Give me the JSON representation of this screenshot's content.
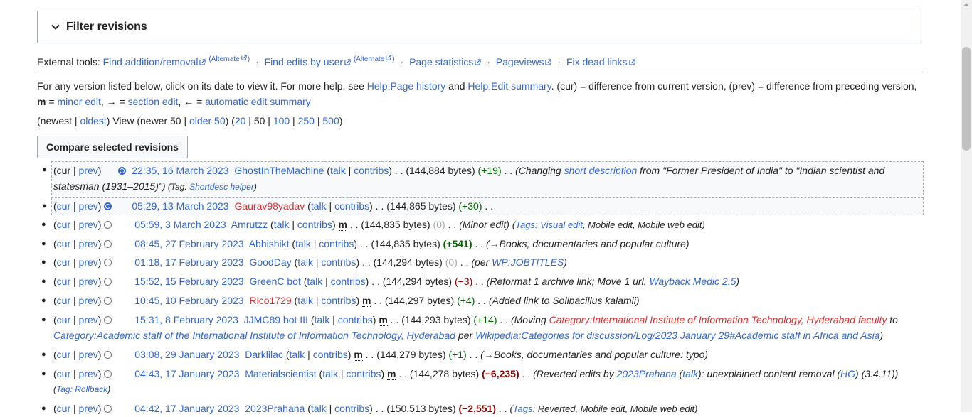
{
  "filter": {
    "title": "Filter revisions"
  },
  "external_tools": {
    "label": "External tools:",
    "find_addition": "Find addition/removal",
    "alternate1": "(Alternate",
    "alternate1_close": ")",
    "find_edits": "Find edits by user",
    "alternate2": "(Alternate",
    "alternate2_close": ")",
    "page_statistics": "Page statistics",
    "pageviews": "Pageviews",
    "fix_dead_links": "Fix dead links",
    "sep": "·"
  },
  "help": {
    "t1": "For any version listed below, click on its date to view it. For more help, see ",
    "help_page_history": "Help:Page history",
    "t2": " and ",
    "help_edit_summary": "Help:Edit summary",
    "t3": ". (cur) = difference from current version, (prev) = difference from preceding version,",
    "m": "m",
    "t4": " = ",
    "minor_edit": "minor edit",
    "t5": ", → = ",
    "section_edit": "section edit",
    "t6": ", ← = ",
    "automatic_edit_summary": "automatic edit summary"
  },
  "nav": {
    "open": "(newest | ",
    "oldest": "oldest",
    "view": ") View (newer 50 | ",
    "older50": "older 50",
    "mid": ") (",
    "n20": "20",
    "s1": " | 50 | ",
    "n100": "100",
    "s2": " | ",
    "n250": "250",
    "s3": " | ",
    "n500": "500",
    "close": ")"
  },
  "compare_button": "Compare selected revisions",
  "revisions": [
    {
      "cur": "cur",
      "prev": "prev",
      "date": "22:35, 16 March 2023",
      "user": "GhostInTheMachine",
      "talk": "talk",
      "contribs": "contribs",
      "bytes": "(144,884 bytes)",
      "diff": "(+19)",
      "s1": "(Changing ",
      "s_link1": "short description",
      "s2": " from \"Former President of India\" to \"Indian scientist and",
      "l2a": "statesman (1931–2015)\")",
      "tag_open": " (Tag: ",
      "tag_link": "Shortdesc helper",
      "tag_close": ")"
    },
    {
      "cur": "cur",
      "prev": "prev",
      "date": "05:29, 13 March 2023",
      "user": "Gaurav98yadav",
      "talk": "talk",
      "contribs": "contribs",
      "bytes": "(144,865 bytes)",
      "diff": "(+30)",
      "dots": ". ."
    },
    {
      "cur": "cur",
      "prev": "prev",
      "date": "05:59, 3 March 2023",
      "user": "Amrutzz",
      "talk": "talk",
      "contribs": "contribs",
      "minor": "m",
      "bytes": "(144,835 bytes)",
      "diff": "(0)",
      "summary": "(Minor edit)",
      "tags_open": "(",
      "tags_label": "Tags:",
      "tag1": " Visual edit",
      "tag_rest": ", Mobile edit, Mobile web edit)"
    },
    {
      "cur": "cur",
      "prev": "prev",
      "date": "08:45, 27 February 2023",
      "user": "Abhishikt",
      "talk": "talk",
      "contribs": "contribs",
      "bytes": "(144,835 bytes)",
      "diff": "(+541)",
      "s_open": "(",
      "arrow": "→",
      "s_rest": "Books, documentaries and popular culture)"
    },
    {
      "cur": "cur",
      "prev": "prev",
      "date": "01:18, 17 February 2023",
      "user": "GoodDay",
      "talk": "talk",
      "contribs": "contribs",
      "bytes": "(144,294 bytes)",
      "diff": "(0)",
      "s_open": "(per ",
      "s_link": "WP:JOBTITLES",
      "s_close": ")"
    },
    {
      "cur": "cur",
      "prev": "prev",
      "date": "15:52, 15 February 2023",
      "user": "GreenC bot",
      "talk": "talk",
      "contribs": "contribs",
      "bytes": "(144,294 bytes)",
      "diff": "(−3)",
      "s_open": "(Reformat 1 archive link; Move 1 url. ",
      "s_link": "Wayback Medic 2.5",
      "s_close": ")"
    },
    {
      "cur": "cur",
      "prev": "prev",
      "date": "10:45, 10 February 2023",
      "user": "Rico1729",
      "talk": "talk",
      "contribs": "contribs",
      "minor": "m",
      "bytes": "(144,297 bytes)",
      "diff": "(+4)",
      "summary": "(Added link to Solibacillus kalamii)"
    },
    {
      "cur": "cur",
      "prev": "prev",
      "date": "15:31, 8 February 2023",
      "user": "JJMC89 bot III",
      "talk": "talk",
      "contribs": "contribs",
      "minor": "m",
      "bytes": "(144,293 bytes)",
      "diff": "(+14)",
      "s_open": "(Moving ",
      "s_redlink": "Category:International Institute of Information Technology, Hyderabad faculty",
      "s_to": " to",
      "l2_link": "Category:Academic staff of the International Institute of Information Technology, Hyderabad",
      "l2_per": " per ",
      "l2_link2": "Wikipedia:Categories for discussion/Log/2023 January 29#Academic staff in Africa and Asia",
      "l2_close": ")"
    },
    {
      "cur": "cur",
      "prev": "prev",
      "date": "03:08, 29 January 2023",
      "user": "Darklilac",
      "talk": "talk",
      "contribs": "contribs",
      "minor": "m",
      "bytes": "(144,279 bytes)",
      "diff": "(+1)",
      "s_open": "(",
      "arrow": "→",
      "s_rest": "Books, documentaries and popular culture:",
      "s_tail": " typo)"
    },
    {
      "cur": "cur",
      "prev": "prev",
      "date": "04:43, 17 January 2023",
      "user": "Materialscientist",
      "talk": "talk",
      "contribs": "contribs",
      "minor": "m",
      "bytes": "(144,278 bytes)",
      "diff": "(−6,235)",
      "s_open": "(Reverted edits by ",
      "s_link": "2023Prahana",
      "s_mid": " (",
      "s_talk": "talk",
      "s_mid2": "): unexplained content removal (",
      "s_hg": "HG",
      "s_end": ") (3.4.11))",
      "l2_open": "(",
      "l2_tag": "Tag:",
      "l2_link": " Rollback",
      "l2_close": ")"
    },
    {
      "cur": "cur",
      "prev": "prev",
      "date": "04:42, 17 January 2023",
      "user": "2023Prahana",
      "talk": "talk",
      "contribs": "contribs",
      "bytes": "(150,513 bytes)",
      "diff": "(−2,551)",
      "tags_open": "(",
      "tags_label": "Tags:",
      "tag_rest": " Reverted, Mobile edit, Mobile web edit)"
    }
  ]
}
